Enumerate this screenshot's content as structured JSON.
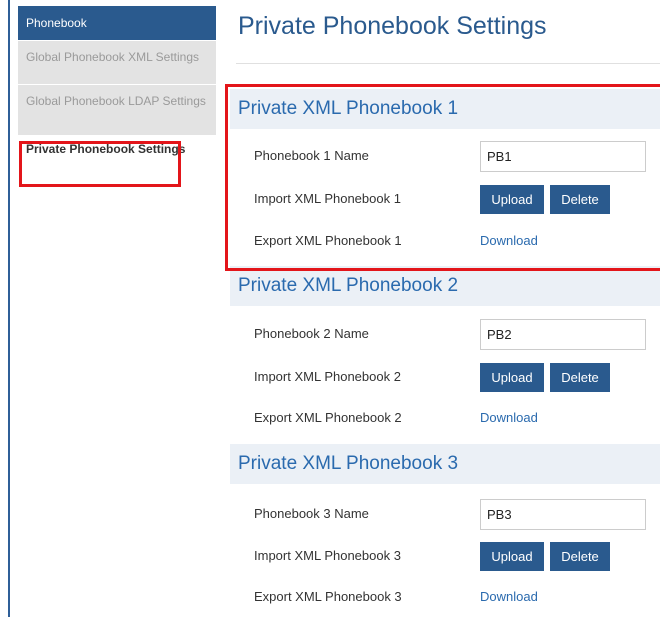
{
  "sidebar": {
    "header": "Phonebook",
    "items": [
      {
        "label": "Global Phonebook XML Settings",
        "active": false
      },
      {
        "label": "Global Phonebook LDAP Settings",
        "active": false
      },
      {
        "label": "Private Phonebook Settings",
        "active": true
      }
    ]
  },
  "page": {
    "title": "Private Phonebook Settings"
  },
  "sections": [
    {
      "title": "Private XML Phonebook 1",
      "name_label": "Phonebook 1 Name",
      "name_value": "PB1",
      "import_label": "Import XML Phonebook 1",
      "upload_label": "Upload",
      "delete_label": "Delete",
      "export_label": "Export XML Phonebook 1",
      "download_label": "Download"
    },
    {
      "title": "Private XML Phonebook 2",
      "name_label": "Phonebook 2 Name",
      "name_value": "PB2",
      "import_label": "Import XML Phonebook 2",
      "upload_label": "Upload",
      "delete_label": "Delete",
      "export_label": "Export XML Phonebook 2",
      "download_label": "Download"
    },
    {
      "title": "Private XML Phonebook 3",
      "name_label": "Phonebook 3 Name",
      "name_value": "PB3",
      "import_label": "Import XML Phonebook 3",
      "upload_label": "Upload",
      "delete_label": "Delete",
      "export_label": "Export XML Phonebook 3",
      "download_label": "Download"
    }
  ],
  "colors": {
    "brand": "#2a5a8e",
    "section_title": "#2a6aae",
    "highlight": "#e3151a"
  }
}
